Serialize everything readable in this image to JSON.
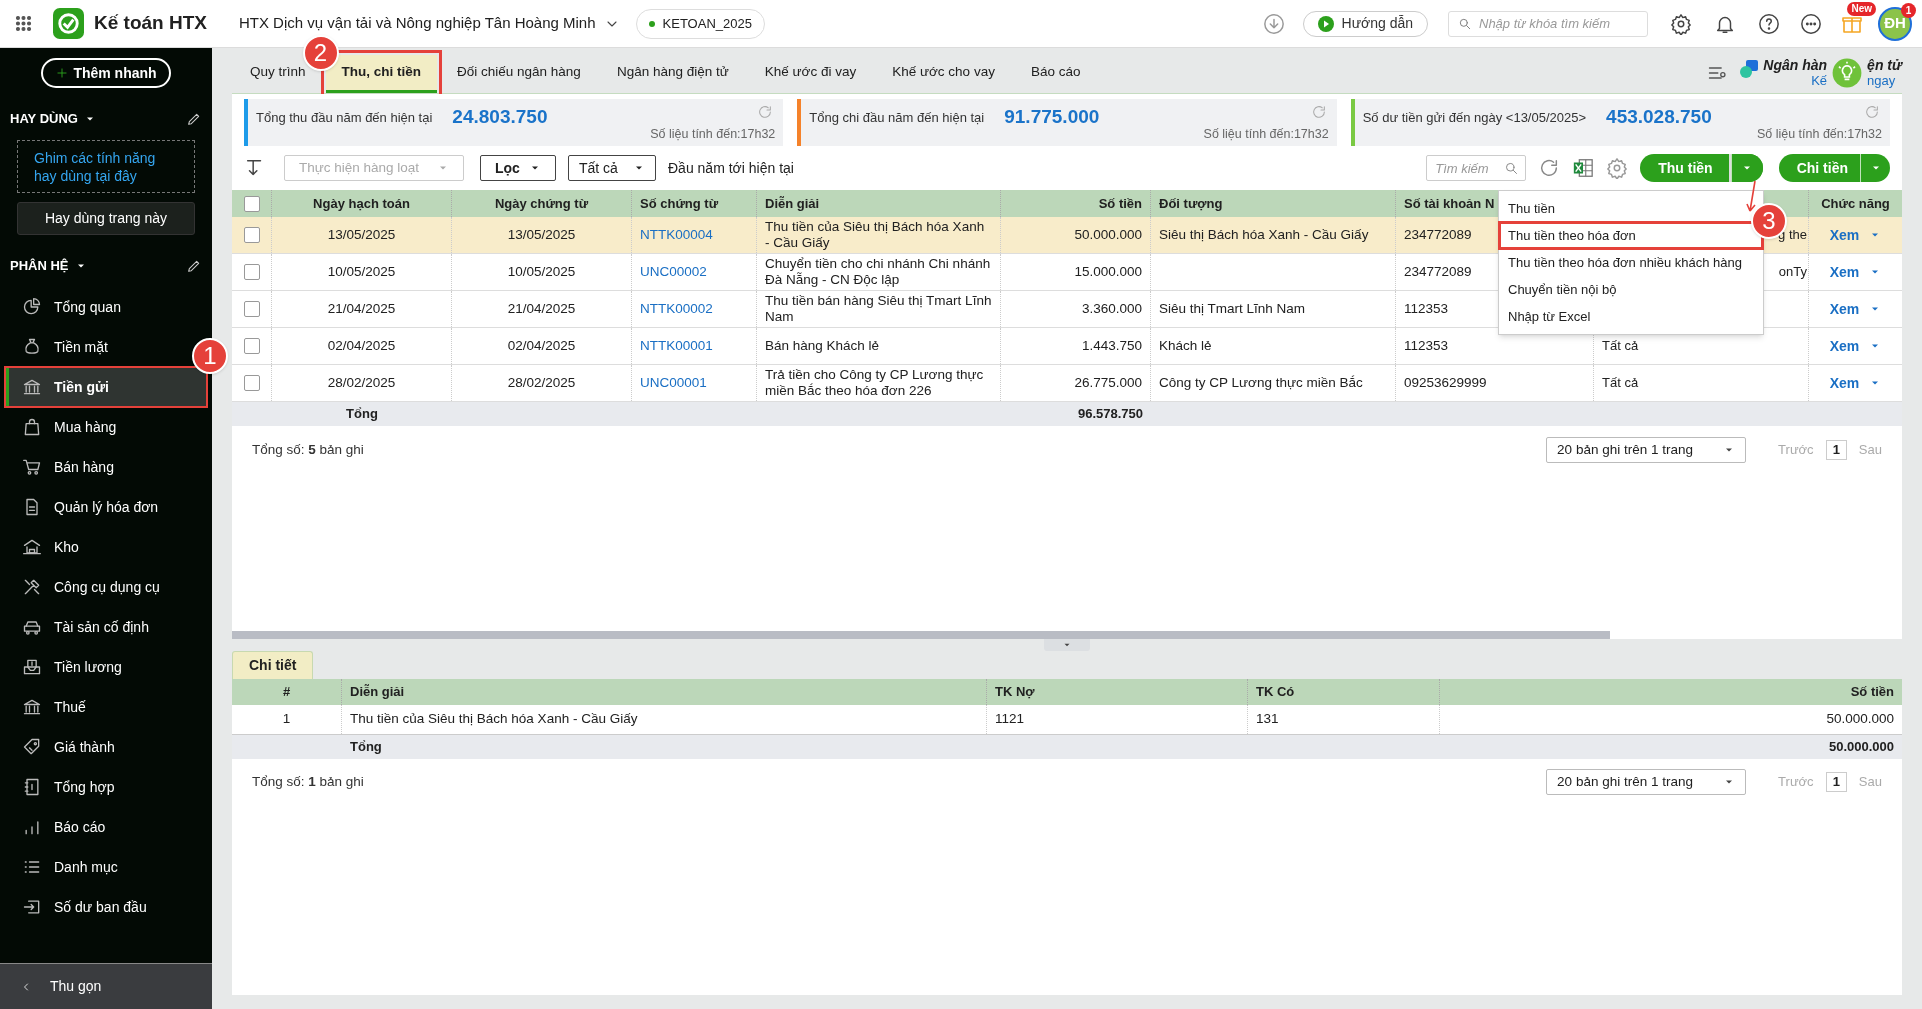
{
  "topbar": {
    "app_name": "Kế toán HTX",
    "company": "HTX Dịch vụ vận tải và Nông nghiệp Tân Hoàng Minh",
    "database": "KETOAN_2025",
    "guide_button": "Hướng dẫn",
    "search": {
      "placeholder": "Nhập từ khóa tìm kiếm"
    },
    "new_badge": "New",
    "avatar": "ĐH",
    "notification_count": "1"
  },
  "sidebar": {
    "quick_add": "Thêm nhanh",
    "favorites_title": "HAY DÙNG",
    "favorites_hint": "Ghim các tính năng hay dùng tại đây",
    "pin_button": "Hay dùng trang này",
    "modules_title": "PHÂN HỆ",
    "items": [
      {
        "label": "Tổng quan",
        "selected": false
      },
      {
        "label": "Tiền mặt",
        "selected": false
      },
      {
        "label": "Tiền gửi",
        "selected": true,
        "callout": "1"
      },
      {
        "label": "Mua hàng",
        "selected": false
      },
      {
        "label": "Bán hàng",
        "selected": false
      },
      {
        "label": "Quản lý hóa đơn",
        "selected": false
      },
      {
        "label": "Kho",
        "selected": false
      },
      {
        "label": "Công cụ dụng cụ",
        "selected": false
      },
      {
        "label": "Tài sản cố định",
        "selected": false
      },
      {
        "label": "Tiền lương",
        "selected": false
      },
      {
        "label": "Thuế",
        "selected": false
      },
      {
        "label": "Giá thành",
        "selected": false
      },
      {
        "label": "Tổng hợp",
        "selected": false
      },
      {
        "label": "Báo cáo",
        "selected": false
      },
      {
        "label": "Danh mục",
        "selected": false
      },
      {
        "label": "Số dư ban đầu",
        "selected": false
      }
    ],
    "collapse": "Thu gọn"
  },
  "tabs": [
    {
      "label": "Quy trình",
      "selected": false
    },
    {
      "label": "Thu, chi tiền",
      "selected": true,
      "callout": "2"
    },
    {
      "label": "Đối chiếu ngân hàng",
      "selected": false
    },
    {
      "label": "Ngân hàng điện tử",
      "selected": false
    },
    {
      "label": "Khế ước đi vay",
      "selected": false
    },
    {
      "label": "Khế ước cho vay",
      "selected": false
    },
    {
      "label": "Báo cáo",
      "selected": false
    }
  ],
  "promo": {
    "title_parts": [
      "Ngân hàn",
      "ện tử"
    ],
    "link_parts": [
      "Kế",
      "ngay"
    ]
  },
  "summary_cards": [
    {
      "label": "Tổng thu đầu năm đến hiện tại",
      "value": "24.803.750",
      "note": "Số liệu tính đến:17h32",
      "color": "#1e9be9"
    },
    {
      "label": "Tổng chi đầu năm đến hiện tại",
      "value": "91.775.000",
      "note": "Số liệu tính đến:17h32",
      "color": "#f5822a"
    },
    {
      "label": "Số dư tiền gửi đến ngày <13/05/2025>",
      "value": "453.028.750",
      "note": "Số liệu tính đến:17h32",
      "color": "#7ac943"
    }
  ],
  "toolbar": {
    "bulk_action": "Thực hiện hàng loạt",
    "filter": "Lọc",
    "scope": "Tất cả",
    "period": "Đầu năm tới hiện tại",
    "search": {
      "placeholder": "Tìm kiếm"
    },
    "receive_button": "Thu tiền",
    "pay_button": "Chi tiền"
  },
  "receive_menu": [
    {
      "label": "Thu tiền"
    },
    {
      "label": "Thu tiền theo hóa đơn",
      "callout": "3"
    },
    {
      "label": "Thu tiền theo hóa đơn nhiều khách hàng"
    },
    {
      "label": "Chuyển tiền nội bộ"
    },
    {
      "label": "Nhập từ Excel"
    }
  ],
  "table": {
    "all_checked": false,
    "columns": [
      "Ngày hạch toán",
      "Ngày chứng từ",
      "Số chứng từ",
      "Diễn giải",
      "Số tiền",
      "Đối tượng",
      "Số tài khoản N",
      "Chức năng"
    ],
    "rows": [
      {
        "selected": true,
        "checked": false,
        "posting_date": "13/05/2025",
        "voucher_date": "13/05/2025",
        "voucher_no": "NTTK00004",
        "description": "Thu tiền của Siêu thị Bách hóa Xanh - Cầu Giấy",
        "amount": "50.000.000",
        "counterpart": "Siêu thị Bách hóa Xanh - Cầu Giấy",
        "bank_account": "234772089",
        "column_9": {
          "text": "g the",
          "clipped": true
        },
        "action": "Xem"
      },
      {
        "selected": false,
        "checked": false,
        "posting_date": "10/05/2025",
        "voucher_date": "10/05/2025",
        "voucher_no": "UNC00002",
        "description": "Chuyển tiền cho chi nhánh Chi nhánh Đà Nẵng - CN Độc lập",
        "amount": "15.000.000",
        "bank_account": "234772089",
        "column_9": {
          "text": "onTy",
          "clipped": true
        },
        "action": "Xem"
      },
      {
        "selected": false,
        "checked": false,
        "posting_date": "21/04/2025",
        "voucher_date": "21/04/2025",
        "voucher_no": "NTTK00002",
        "description": "Thu tiền bán hàng Siêu thị Tmart Lĩnh Nam",
        "amount": "3.360.000",
        "counterpart": "Siêu thị Tmart Lĩnh Nam",
        "bank_account": "112353",
        "action": "Xem"
      },
      {
        "selected": false,
        "checked": false,
        "posting_date": "02/04/2025",
        "voucher_date": "02/04/2025",
        "voucher_no": "NTTK00001",
        "description": "Bán hàng Khách lẻ",
        "amount": "1.443.750",
        "counterpart": "Khách lẻ",
        "bank_account": "112353",
        "column_9": {
          "text": "Tất cả",
          "clipped": false
        },
        "action": "Xem"
      },
      {
        "selected": false,
        "checked": false,
        "posting_date": "28/02/2025",
        "voucher_date": "28/02/2025",
        "voucher_no": "UNC00001",
        "description": "Trả tiền cho Công ty CP Lương thực miền Bắc theo hóa đơn 226",
        "amount": "26.775.000",
        "counterpart": "Công ty CP Lương thực miền Bắc",
        "bank_account": "09253629999",
        "column_9": {
          "text": "Tất cả",
          "clipped": false
        },
        "action": "Xem"
      }
    ],
    "total_label": "Tổng",
    "total_amount": "96.578.750",
    "record_count": "Tổng số: **5** bản ghi",
    "pagination": {
      "page_size": "20 bản ghi trên 1 trang",
      "prev": "Trước",
      "page": "1",
      "next": "Sau"
    }
  },
  "detail": {
    "tab": "Chi tiết",
    "columns": [
      "#",
      "Diễn giải",
      "TK Nợ",
      "TK Có",
      "Số tiền"
    ],
    "rows": [
      {
        "no": "1",
        "description": "Thu tiền của Siêu thị Bách hóa Xanh - Cầu Giấy",
        "debit": "1121",
        "credit": "131",
        "amount": "50.000.000"
      }
    ],
    "total_label": "Tổng",
    "total_amount": "50.000.000",
    "record_count": "Tổng số: **1** bản ghi",
    "pagination": {
      "page_size": "20 bản ghi trên 1 trang",
      "prev": "Trước",
      "page": "1",
      "next": "Sau"
    }
  }
}
